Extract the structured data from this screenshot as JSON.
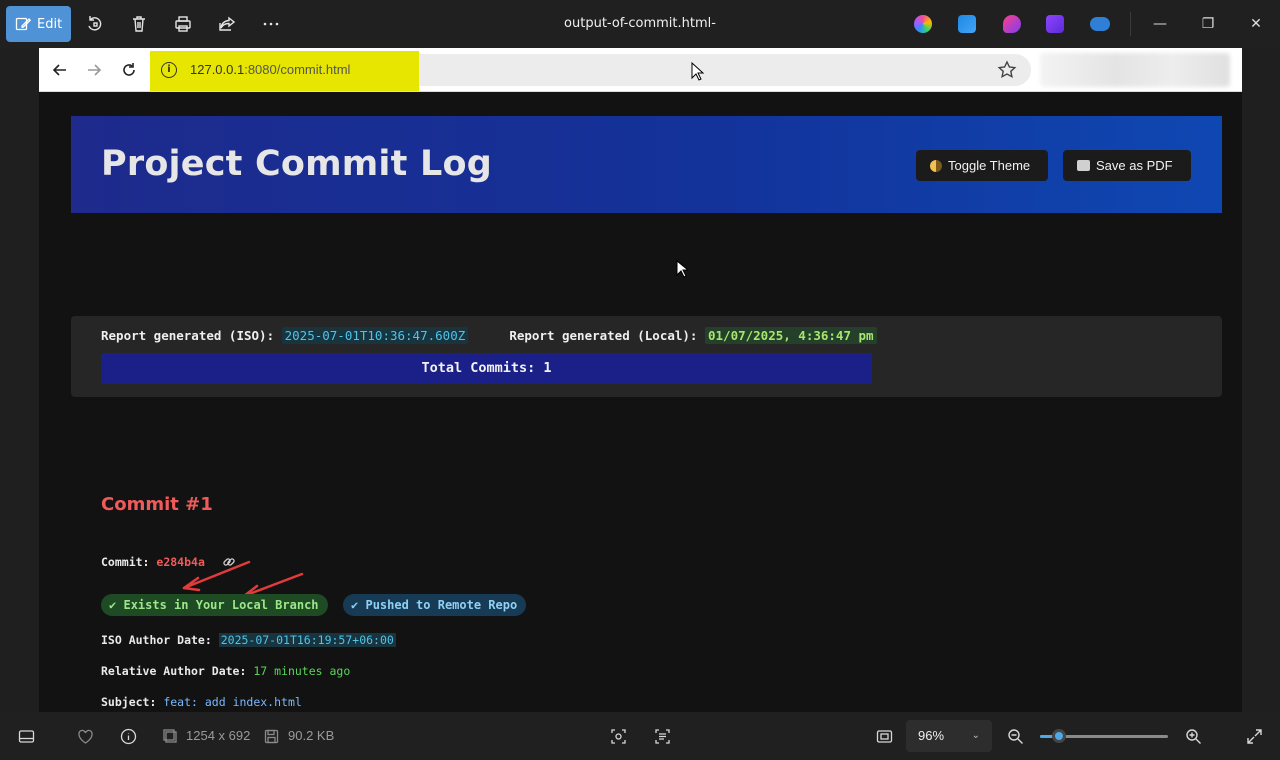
{
  "app": {
    "edit_label": "Edit",
    "file_title": "output-of-commit.html-file.png",
    "colors": {
      "accent": "#4f93d6",
      "chrome": "#202020"
    }
  },
  "browser": {
    "url_host": "127.0.0.1",
    "url_rest": ":8080/commit.html"
  },
  "page": {
    "header_title": "Project Commit Log",
    "toggle_theme_label": "Toggle Theme",
    "save_pdf_label": "Save as PDF",
    "report_iso_label": "Report generated (ISO):",
    "report_iso_value": "2025-07-01T10:36:47.600Z",
    "report_local_label": "Report generated (Local):",
    "report_local_value": "01/07/2025, 4:36:47 pm",
    "total_commits": "Total Commits: 1",
    "commit": {
      "title": "Commit #1",
      "hash_label": "Commit:",
      "hash": "e284b4a",
      "badge_local": "Exists in Your Local Branch",
      "badge_remote": "Pushed to Remote Repo",
      "iso_date_label": "ISO Author Date:",
      "iso_date": "2025-07-01T16:19:57+06:00",
      "relative_date_label": "Relative Author Date:",
      "relative_date": "17 minutes ago",
      "subject_label": "Subject:",
      "subject": "feat: add index.html"
    }
  },
  "bottombar": {
    "dimensions": "1254 x 692",
    "file_size": "90.2 KB",
    "zoom": "96%",
    "zoom_level": 0.15
  }
}
